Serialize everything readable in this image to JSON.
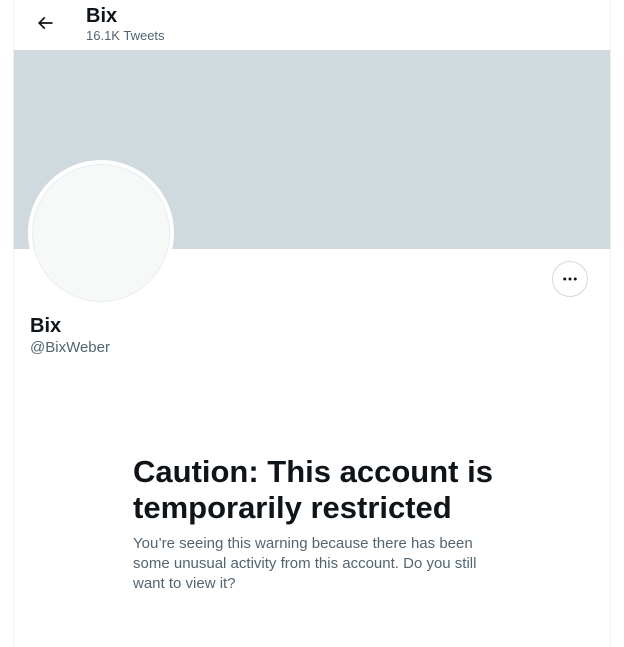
{
  "header": {
    "name": "Bix",
    "tweet_count": "16.1K Tweets",
    "back_icon": "arrow-left-icon"
  },
  "profile": {
    "name": "Bix",
    "handle": "@BixWeber",
    "more_icon": "more-horizontal-icon",
    "banner_color": "#cfd9de",
    "avatar_color": "#f7f9f9"
  },
  "warning": {
    "title": "Caution: This account is temporarily restricted",
    "body": "You’re seeing this warning because there has been some unusual activity from this account. Do you still want to view it?"
  }
}
